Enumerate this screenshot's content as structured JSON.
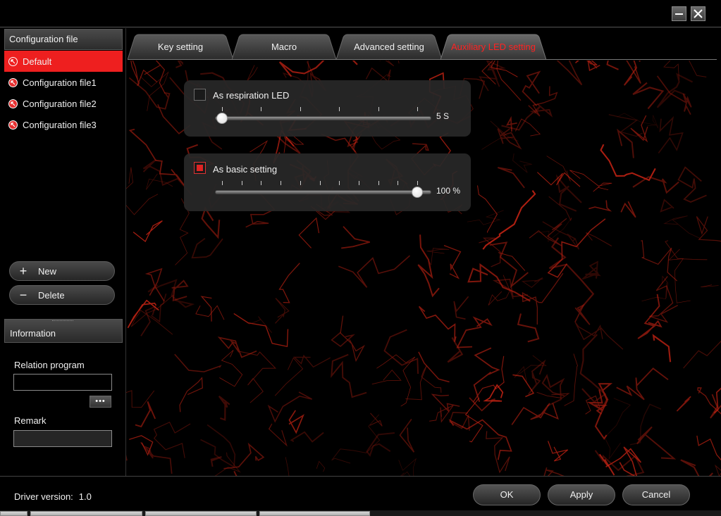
{
  "window": {
    "minimize_icon": "minus-icon",
    "close_icon": "close-icon"
  },
  "sidebar": {
    "header": "Configuration file",
    "profiles": [
      {
        "label": "Default",
        "active": true
      },
      {
        "label": "Configuration file1",
        "active": false
      },
      {
        "label": "Configuration file2",
        "active": false
      },
      {
        "label": "Configuration file3",
        "active": false
      }
    ],
    "new_label": "New",
    "delete_label": "Delete"
  },
  "information": {
    "header": "Information",
    "relation_label": "Relation program",
    "relation_value": "",
    "browse_label": "•••",
    "remark_label": "Remark",
    "remark_value": ""
  },
  "tabs": [
    {
      "label": "Key setting",
      "active": false
    },
    {
      "label": "Macro",
      "active": false
    },
    {
      "label": "Advanced setting",
      "active": false
    },
    {
      "label": "Auxiliary LED setting",
      "active": true
    }
  ],
  "led": {
    "respiration": {
      "label": "As respiration LED",
      "checked": false,
      "value_text": "5 S",
      "level": 0.0
    },
    "basic": {
      "label": "As basic setting",
      "checked": true,
      "value_text": "100 %",
      "level": 1.0
    }
  },
  "footer": {
    "driver_label": "Driver version:",
    "driver_value": "1.0",
    "ok_label": "OK",
    "apply_label": "Apply",
    "cancel_label": "Cancel"
  },
  "colors": {
    "accent": "#ee1f1f",
    "background": "#000000",
    "panel": "#282828"
  }
}
